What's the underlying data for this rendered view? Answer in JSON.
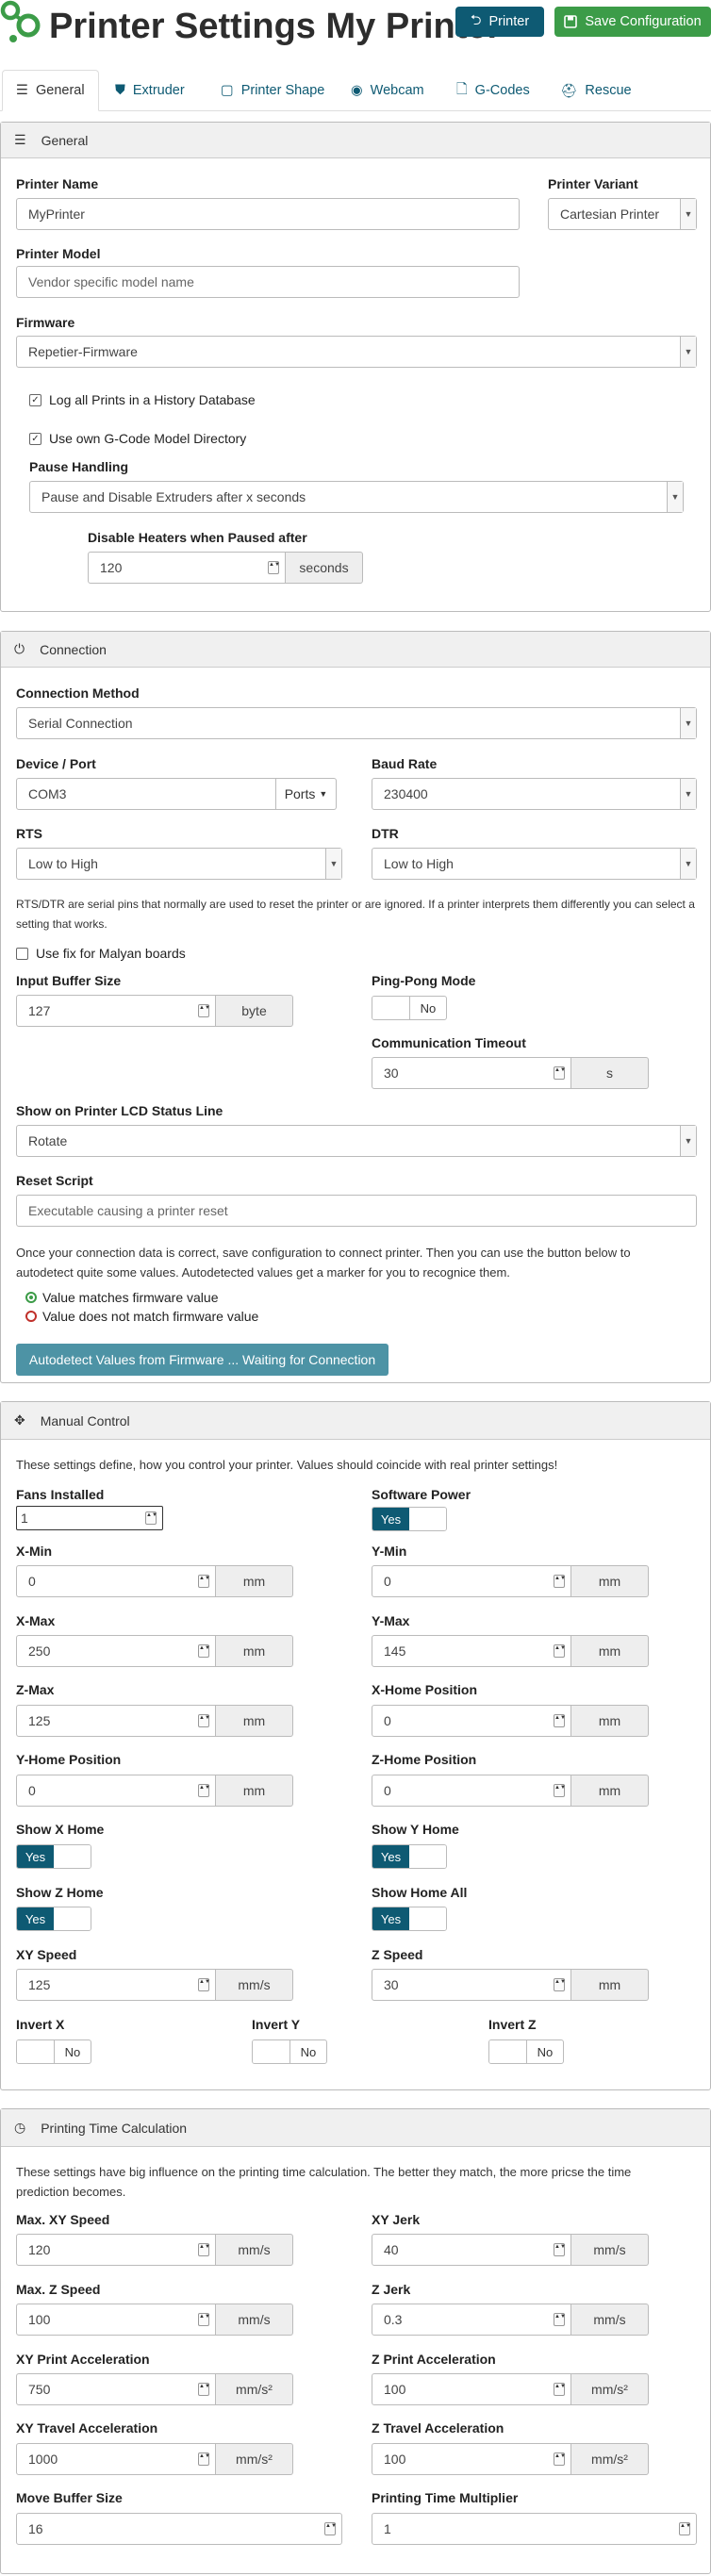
{
  "header": {
    "title": "Printer Settings My Printer",
    "printer_button": "Printer",
    "save_button": "Save Configuration"
  },
  "tabs": [
    "General",
    "Extruder",
    "Printer Shape",
    "Webcam",
    "G-Codes",
    "Rescue"
  ],
  "general": {
    "heading": "General",
    "printer_name_label": "Printer Name",
    "printer_name_value": "MyPrinter",
    "variant_label": "Printer Variant",
    "variant_value": "Cartesian Printer",
    "model_label": "Printer Model",
    "model_placeholder": "Vendor specific model name",
    "firmware_label": "Firmware",
    "firmware_value": "Repetier-Firmware",
    "log_prints": "Log all Prints in a History Database",
    "own_gcode": "Use own G-Code Model Directory",
    "pause_label": "Pause Handling",
    "pause_value": "Pause and Disable Extruders after x seconds",
    "disable_heaters_label": "Disable Heaters when Paused after",
    "disable_heaters_value": "120",
    "disable_heaters_unit": "seconds"
  },
  "connection": {
    "heading": "Connection",
    "method_label": "Connection Method",
    "method_value": "Serial Connection",
    "port_label": "Device / Port",
    "port_value": "COM3",
    "ports_button": "Ports",
    "baud_label": "Baud Rate",
    "baud_value": "230400",
    "rts_label": "RTS",
    "rts_value": "Low to High",
    "dtr_label": "DTR",
    "dtr_value": "Low to High",
    "rts_note_1": "RTS/DTR are serial pins that normally are used to reset the printer or are ignored. If a printer interprets them differently you can select a",
    "rts_note_2": "setting that works.",
    "malyan": "Use fix for Malyan boards",
    "buffer_label": "Input Buffer Size",
    "buffer_value": "127",
    "buffer_unit": "byte",
    "pingpong_label": "Ping-Pong Mode",
    "pingpong_value": "No",
    "timeout_label": "Communication Timeout",
    "timeout_value": "30",
    "timeout_unit": "s",
    "lcd_label": "Show on Printer LCD Status Line",
    "lcd_value": "Rotate",
    "reset_label": "Reset Script",
    "reset_placeholder": "Executable causing a printer reset",
    "info_1": "Once your connection data is correct, save configuration to connect printer. Then you can use the button below to",
    "info_2": "autodetect quite some values. Autodetected values get a marker for you to recognice them.",
    "match_label": "Value matches firmware value",
    "mismatch_label": "Value does not match firmware value",
    "autodetect_button": "Autodetect Values from Firmware ... Waiting for Connection"
  },
  "manual": {
    "heading": "Manual Control",
    "intro": "These settings define, how you control your printer. Values should coincide with real printer settings!",
    "fans_label": "Fans Installed",
    "fans_value": "1",
    "power_label": "Software Power",
    "power_value": "Yes",
    "xmin_label": "X-Min",
    "xmin_value": "0",
    "ymin_label": "Y-Min",
    "ymin_value": "0",
    "xmax_label": "X-Max",
    "xmax_value": "250",
    "ymax_label": "Y-Max",
    "ymax_value": "145",
    "zmax_label": "Z-Max",
    "zmax_value": "125",
    "xhome_label": "X-Home Position",
    "xhome_value": "0",
    "yhome_label": "Y-Home Position",
    "yhome_value": "0",
    "zhome_label": "Z-Home Position",
    "zhome_value": "0",
    "showx_label": "Show X Home",
    "showx_value": "Yes",
    "showy_label": "Show Y Home",
    "showy_value": "Yes",
    "showz_label": "Show Z Home",
    "showz_value": "Yes",
    "showall_label": "Show Home All",
    "showall_value": "Yes",
    "xyspeed_label": "XY Speed",
    "xyspeed_value": "125",
    "xyspeed_unit": "mm/s",
    "zspeed_label": "Z Speed",
    "zspeed_value": "30",
    "zspeed_unit": "mm",
    "mm": "mm",
    "invx_label": "Invert X",
    "invx_value": "No",
    "invy_label": "Invert Y",
    "invy_value": "No",
    "invz_label": "Invert Z",
    "invz_value": "No"
  },
  "timing": {
    "heading": "Printing Time Calculation",
    "intro_1": "These settings have big influence on the printing time calculation. The better they match, the more pricse the time",
    "intro_2": "prediction becomes.",
    "maxxy_label": "Max. XY Speed",
    "maxxy_value": "120",
    "maxxy_unit": "mm/s",
    "xyjerk_label": "XY Jerk",
    "xyjerk_value": "40",
    "xyjerk_unit": "mm/s",
    "maxz_label": "Max. Z Speed",
    "maxz_value": "100",
    "maxz_unit": "mm/s",
    "zjerk_label": "Z Jerk",
    "zjerk_value": "0.3",
    "zjerk_unit": "mm/s",
    "xyacc_label": "XY Print Acceleration",
    "xyacc_value": "750",
    "xyacc_unit": "mm/s²",
    "zacc_label": "Z Print Acceleration",
    "zacc_value": "100",
    "zacc_unit": "mm/s²",
    "xytravel_label": "XY Travel Acceleration",
    "xytravel_value": "1000",
    "xytravel_unit": "mm/s²",
    "ztravel_label": "Z Travel Acceleration",
    "ztravel_value": "100",
    "ztravel_unit": "mm/s²",
    "movebuf_label": "Move Buffer Size",
    "movebuf_value": "16",
    "multiplier_label": "Printing Time Multiplier",
    "multiplier_value": "1"
  }
}
